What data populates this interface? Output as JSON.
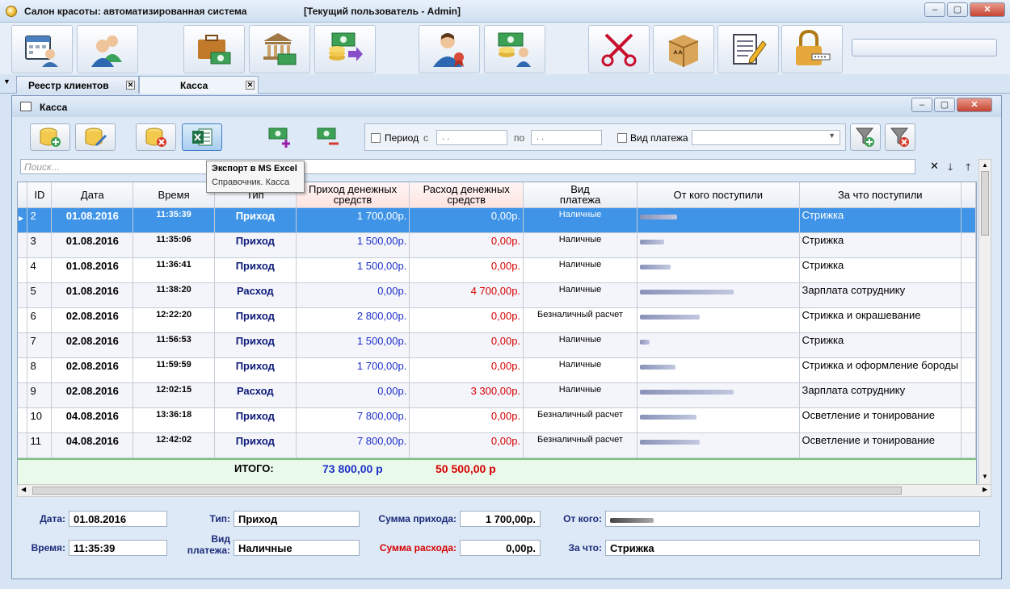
{
  "window": {
    "title": "Салон красоты: автоматизированная система",
    "user": "[Текущий пользователь - Admin]"
  },
  "tabs": [
    {
      "label": "Реестр клиентов"
    },
    {
      "label": "Касса"
    }
  ],
  "inner": {
    "title": "Касса"
  },
  "filter": {
    "period_label": "Период",
    "from_label": "с",
    "to_label": "по",
    "date_placeholder": ". .",
    "payment_type_label": "Вид платежа"
  },
  "search": {
    "placeholder": "Поиск..."
  },
  "tooltip": {
    "title": "Экспорт в MS Excel",
    "subtitle": "Справочник. Касса"
  },
  "columns": [
    "ID",
    "Дата",
    "Время",
    "Тип",
    "Приход денежных средств",
    "Расход денежных средств",
    "Вид платежа",
    "От кого поступили",
    "За что поступили"
  ],
  "rows": [
    {
      "id": "2",
      "date": "01.08.2016",
      "time": "11:35:39",
      "type": "Приход",
      "income": "1 700,00р.",
      "expense": "0,00р.",
      "pay": "Наличные",
      "what": "Стрижка"
    },
    {
      "id": "3",
      "date": "01.08.2016",
      "time": "11:35:06",
      "type": "Приход",
      "income": "1 500,00р.",
      "expense": "0,00р.",
      "pay": "Наличные",
      "what": "Стрижка"
    },
    {
      "id": "4",
      "date": "01.08.2016",
      "time": "11:36:41",
      "type": "Приход",
      "income": "1 500,00р.",
      "expense": "0,00р.",
      "pay": "Наличные",
      "what": "Стрижка"
    },
    {
      "id": "5",
      "date": "01.08.2016",
      "time": "11:38:20",
      "type": "Расход",
      "income": "0,00р.",
      "expense": "4 700,00р.",
      "pay": "Наличные",
      "what": "Зарплата сотруднику"
    },
    {
      "id": "6",
      "date": "02.08.2016",
      "time": "12:22:20",
      "type": "Приход",
      "income": "2 800,00р.",
      "expense": "0,00р.",
      "pay": "Безналичный расчет",
      "what": "Стрижка и окрашевание"
    },
    {
      "id": "7",
      "date": "02.08.2016",
      "time": "11:56:53",
      "type": "Приход",
      "income": "1 500,00р.",
      "expense": "0,00р.",
      "pay": "Наличные",
      "what": "Стрижка"
    },
    {
      "id": "8",
      "date": "02.08.2016",
      "time": "11:59:59",
      "type": "Приход",
      "income": "1 700,00р.",
      "expense": "0,00р.",
      "pay": "Наличные",
      "what": "Стрижка и оформление бороды"
    },
    {
      "id": "9",
      "date": "02.08.2016",
      "time": "12:02:15",
      "type": "Расход",
      "income": "0,00р.",
      "expense": "3 300,00р.",
      "pay": "Наличные",
      "what": "Зарплата сотруднику"
    },
    {
      "id": "10",
      "date": "04.08.2016",
      "time": "13:36:18",
      "type": "Приход",
      "income": "7 800,00р.",
      "expense": "0,00р.",
      "pay": "Безналичный расчет",
      "what": "Осветление и тонирование"
    },
    {
      "id": "11",
      "date": "04.08.2016",
      "time": "12:42:02",
      "type": "Приход",
      "income": "7 800,00р.",
      "expense": "0,00р.",
      "pay": "Безналичный расчет",
      "what": "Осветление и тонирование"
    }
  ],
  "totals": {
    "label": "ИТОГО:",
    "income": "73 800,00 р",
    "expense": "50 500,00 р"
  },
  "details": {
    "date_label": "Дата:",
    "date": "01.08.2016",
    "time_label": "Время:",
    "time": "11:35:39",
    "type_label": "Тип:",
    "type": "Приход",
    "pay_label": "Вид платежа:",
    "pay": "Наличные",
    "income_label": "Сумма прихода:",
    "income": "1 700,00р.",
    "expense_label": "Сумма расхода:",
    "expense": "0,00р.",
    "from_label": "От кого:",
    "what_label": "За что:",
    "what": "Стрижка"
  },
  "colors": {
    "selected_row": "#3f94e8",
    "income": "#1d2fc9",
    "expense": "#d60000",
    "totals_bg": "#eafaea"
  }
}
